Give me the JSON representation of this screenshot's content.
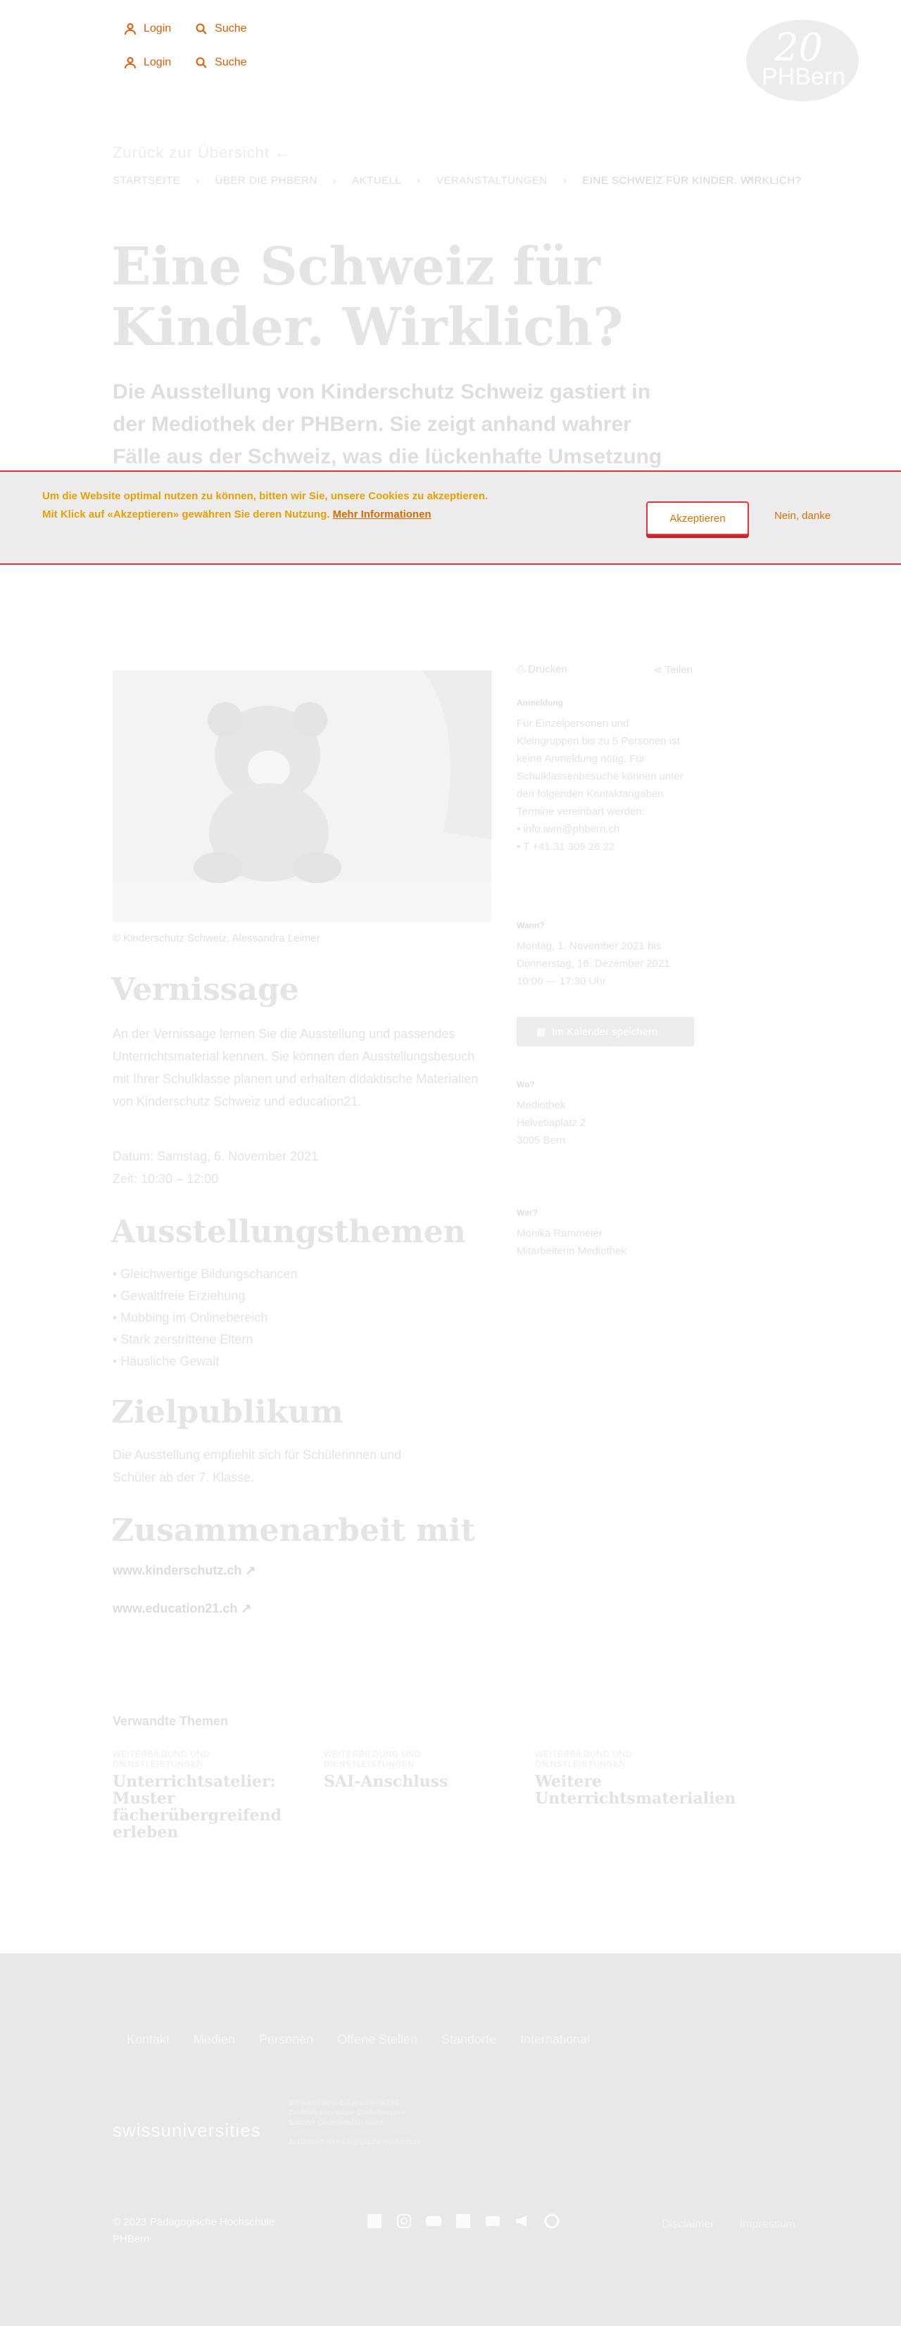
{
  "header": {
    "login_label": "Login",
    "search_label": "Suche",
    "logo_number": "20",
    "logo_brand": "PHBern"
  },
  "nav": {
    "back_label": "Zurück zur Übersicht ←",
    "breadcrumb": [
      "STARTSEITE",
      "ÜBER DIE PHBERN",
      "AKTUELL",
      "VERANSTALTUNGEN",
      "EINE SCHWEIZ FÜR KINDER. WIRKLICH?"
    ]
  },
  "page": {
    "title": "Eine Schweiz für Kinder. Wirklich?",
    "lead": "Die Ausstellung von Kinderschutz Schweiz gastiert in der Mediothek der PHBern. Sie zeigt anhand wahrer Fälle aus der Schweiz, was die lückenhafte Umsetzung der UNO-Kinderrechtskonvention für Kinder bedeutet und regt zur Auseinandersetzung mit den Kinderrechten an."
  },
  "cookie": {
    "line1": "Um die Website optimal nutzen zu können, bitten wir Sie, unsere Cookies zu akzeptieren.",
    "line2": "Mit Klick auf «Akzeptieren» gewähren Sie deren Nutzung.",
    "more_link": "Mehr Informationen",
    "accept": "Akzeptieren",
    "decline": "Nein, danke"
  },
  "media": {
    "credit": "© Kinderschutz Schweiz, Alessandra Leimer"
  },
  "sections": {
    "vernissage_title": "Vernissage",
    "vernissage_text": "An der Vernissage lernen Sie die Ausstellung und passendes Unterrichtsmaterial kennen. Sie können den Ausstellungsbesuch mit Ihrer Schulklasse planen und erhalten didaktische Materialien von Kinderschutz Schweiz und education21.",
    "vernissage_date": "Datum: Samstag, 6. November 2021",
    "vernissage_time": "Zeit: 10:30 – 12:00",
    "themen_title": "Ausstellungsthemen",
    "themen": [
      "• Gleichwertige Bildungschancen",
      "• Gewaltfreie Erziehung",
      "• Mobbing im Onlinebereich",
      "• Stark zerstrittene Eltern",
      "• Häusliche Gewalt"
    ],
    "zielpublikum_title": "Zielpublikum",
    "zielpublikum_text": "Die Ausstellung empfiehlt sich für Schülerinnen und Schüler ab der 7. Klasse.",
    "zusammen_title": "Zusammenarbeit mit",
    "links": [
      "www.kinderschutz.ch ↗",
      "www.education21.ch ↗"
    ]
  },
  "sidebar": {
    "print": "Drucken",
    "share": "Teilen",
    "anmeldung_label": "Anmeldung",
    "anmeldung_text": "Für Einzelpersonen und Kleingruppen bis zu 5 Personen ist keine Anmeldung nötig. Für Schulklassenbesuche können unter den folgenden Kontaktangaben Termine vereinbart werden:",
    "email": "• info.iwm@phbern.ch",
    "phone": "• T +41 31 309 28 22",
    "wann_label": "Wann?",
    "wann_text": "Montag, 1. November 2021 bis Donnerstag, 16. Dezember 2021",
    "wann_time": "10:00 — 17:30 Uhr",
    "calendar_button": "Im Kalender speichern",
    "wo_label": "Wo?",
    "wo_text": [
      "Mediothek",
      "Helvetiaplatz 2",
      "3005 Bern"
    ],
    "wer_label": "Wer?",
    "wer_text": [
      "Monika Rammeier",
      "Mitarbeiterin Mediothek"
    ]
  },
  "related": {
    "heading": "Verwandte Themen",
    "cards": [
      {
        "category": "WEITERBILDUNG UND DIENSTLEISTUNGEN",
        "title": "Unterrichtsatelier: Muster fächerübergreifend erleben"
      },
      {
        "category": "WEITERBILDUNG UND DIENSTLEISTUNGEN",
        "title": "SAI-Anschluss"
      },
      {
        "category": "WEITERBILDUNG UND DIENSTLEISTUNGEN",
        "title": "Weitere Unterrichtsmaterialien"
      }
    ]
  },
  "footer": {
    "nav": [
      "Kontakt",
      "Medien",
      "Personen",
      "Offene Stellen",
      "Standorte",
      "International"
    ],
    "swissuniversities": "swissuniversities",
    "fed_text": "Schweizerische Eidgenossenschaft Confédération suisse Confederazione Svizzera Confederaziun svizra",
    "fed_sub": "Akkreditiert als Pädagogische Hochschule",
    "copyright": "© 2023 Pädagogische Hochschule PHBern",
    "socials": [
      "facebook-icon",
      "instagram-icon",
      "youtube-icon",
      "linkedin-icon",
      "newsletter-icon",
      "megaphone-icon",
      "google-icon"
    ],
    "legal": [
      "Disclaimer",
      "Impressum"
    ]
  }
}
